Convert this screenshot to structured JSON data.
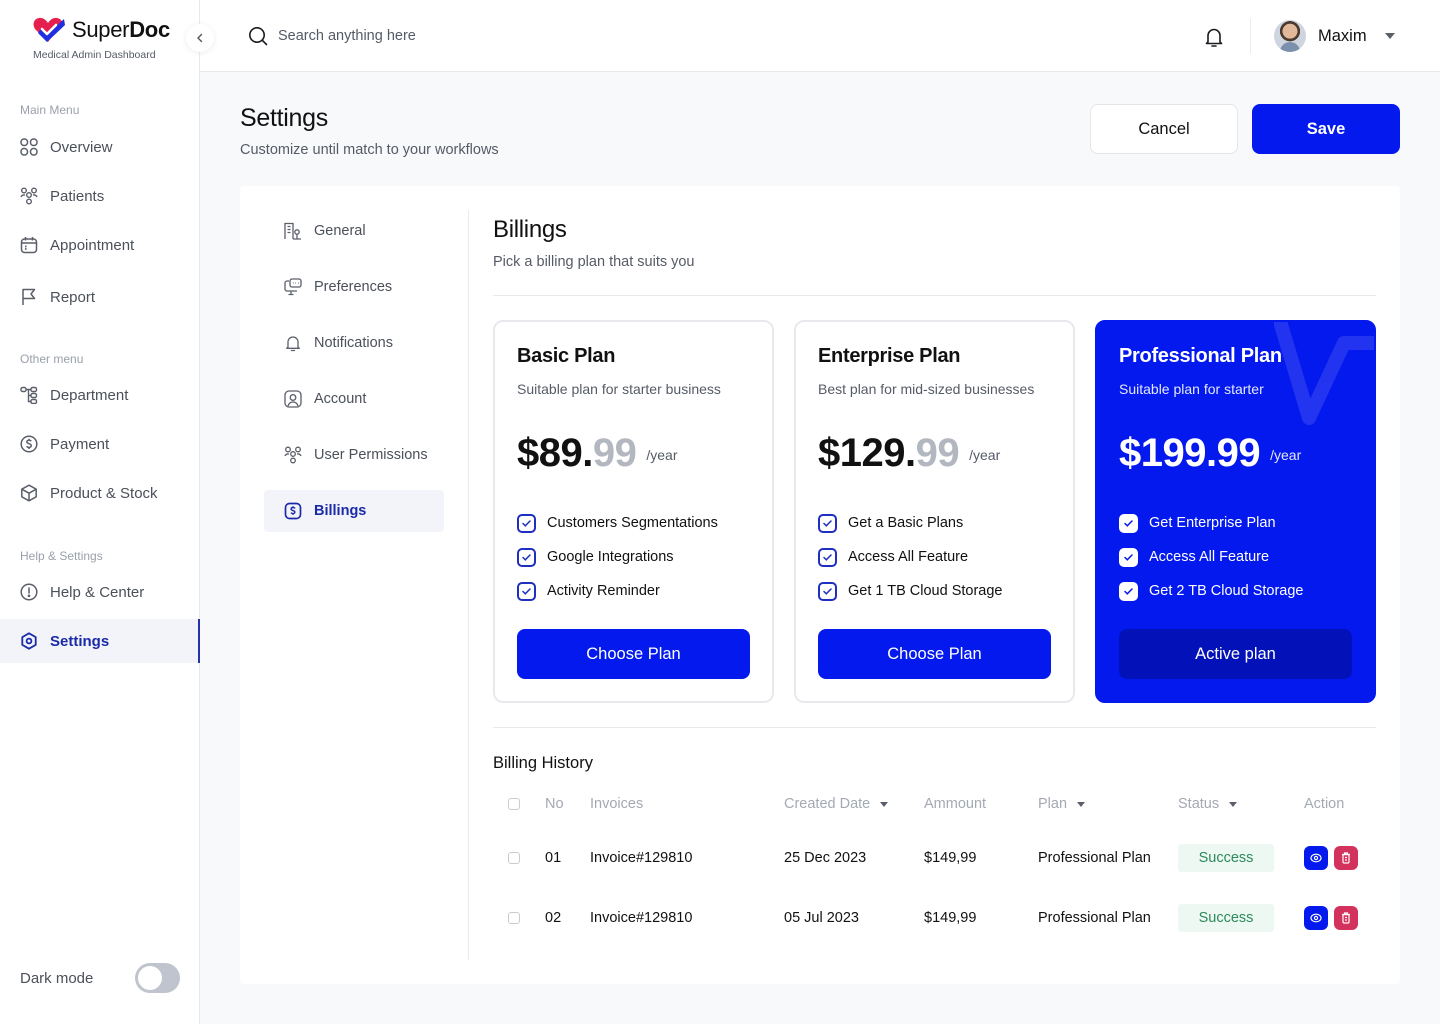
{
  "brand": {
    "name_light": "Super",
    "name_bold": "Doc",
    "subtitle": "Medical Admin Dashboard",
    "accent": "#0419EE",
    "logo_red": "#E5204F"
  },
  "sidebar": {
    "sections": [
      {
        "heading": "Main Menu",
        "items": [
          {
            "label": "Overview",
            "icon": "grid-icon"
          },
          {
            "label": "Patients",
            "icon": "users-icon"
          },
          {
            "label": "Appointment",
            "icon": "calendar-icon"
          },
          {
            "label": "Report",
            "icon": "flag-icon"
          }
        ]
      },
      {
        "heading": "Other menu",
        "items": [
          {
            "label": "Department",
            "icon": "hierarchy-icon"
          },
          {
            "label": "Payment",
            "icon": "dollar-circle-icon"
          },
          {
            "label": "Product & Stock",
            "icon": "box-icon"
          }
        ]
      },
      {
        "heading": "Help & Settings",
        "items": [
          {
            "label": "Help & Center",
            "icon": "info-circle-icon"
          },
          {
            "label": "Settings",
            "icon": "settings-icon",
            "active": true
          }
        ]
      }
    ],
    "dark_mode": {
      "label": "Dark mode",
      "enabled": false
    }
  },
  "topbar": {
    "search_placeholder": "Search anything here",
    "user_name": "Maxim"
  },
  "header": {
    "title": "Settings",
    "subtitle": "Customize until match to your workflows",
    "cancel_label": "Cancel",
    "save_label": "Save"
  },
  "settings_nav": [
    {
      "label": "General",
      "icon": "building-icon"
    },
    {
      "label": "Preferences",
      "icon": "monitor-chat-icon"
    },
    {
      "label": "Notifications",
      "icon": "bell-icon"
    },
    {
      "label": "Account",
      "icon": "user-square-icon"
    },
    {
      "label": "User Permissions",
      "icon": "users-icon"
    },
    {
      "label": "Billings",
      "icon": "dollar-square-icon",
      "active": true
    }
  ],
  "billings": {
    "title": "Billings",
    "subtitle": "Pick a billing plan that suits you",
    "plans": [
      {
        "name": "Basic Plan",
        "description": "Suitable plan for starter business",
        "price_main": "$89.",
        "price_cents": "99",
        "period": "/year",
        "features": [
          "Customers Segmentations",
          "Google Integrations",
          "Activity Reminder"
        ],
        "button": "Choose Plan",
        "active": false
      },
      {
        "name": "Enterprise Plan",
        "description": "Best plan for mid-sized businesses",
        "price_main": "$129.",
        "price_cents": "99",
        "period": "/year",
        "features": [
          "Get a Basic Plans",
          "Access All Feature",
          "Get 1 TB Cloud Storage"
        ],
        "button": "Choose Plan",
        "active": false
      },
      {
        "name": "Professional Plan",
        "description": "Suitable plan for starter",
        "price_main": "$199.",
        "price_cents": "99",
        "period": "/year",
        "features": [
          "Get Enterprise Plan",
          "Access All Feature",
          "Get 2 TB Cloud Storage"
        ],
        "button": "Active plan",
        "active": true
      }
    ]
  },
  "billing_history": {
    "title": "Billing History",
    "columns": [
      "No",
      "Invoices",
      "Created Date",
      "Ammount",
      "Plan",
      "Status",
      "Action"
    ],
    "rows": [
      {
        "no": "01",
        "invoice": "Invoice#129810",
        "date": "25 Dec 2023",
        "amount": "$149,99",
        "plan": "Professional Plan",
        "status": "Success"
      },
      {
        "no": "02",
        "invoice": "Invoice#129810",
        "date": "05 Jul 2023",
        "amount": "$149,99",
        "plan": "Professional Plan",
        "status": "Success"
      }
    ]
  }
}
